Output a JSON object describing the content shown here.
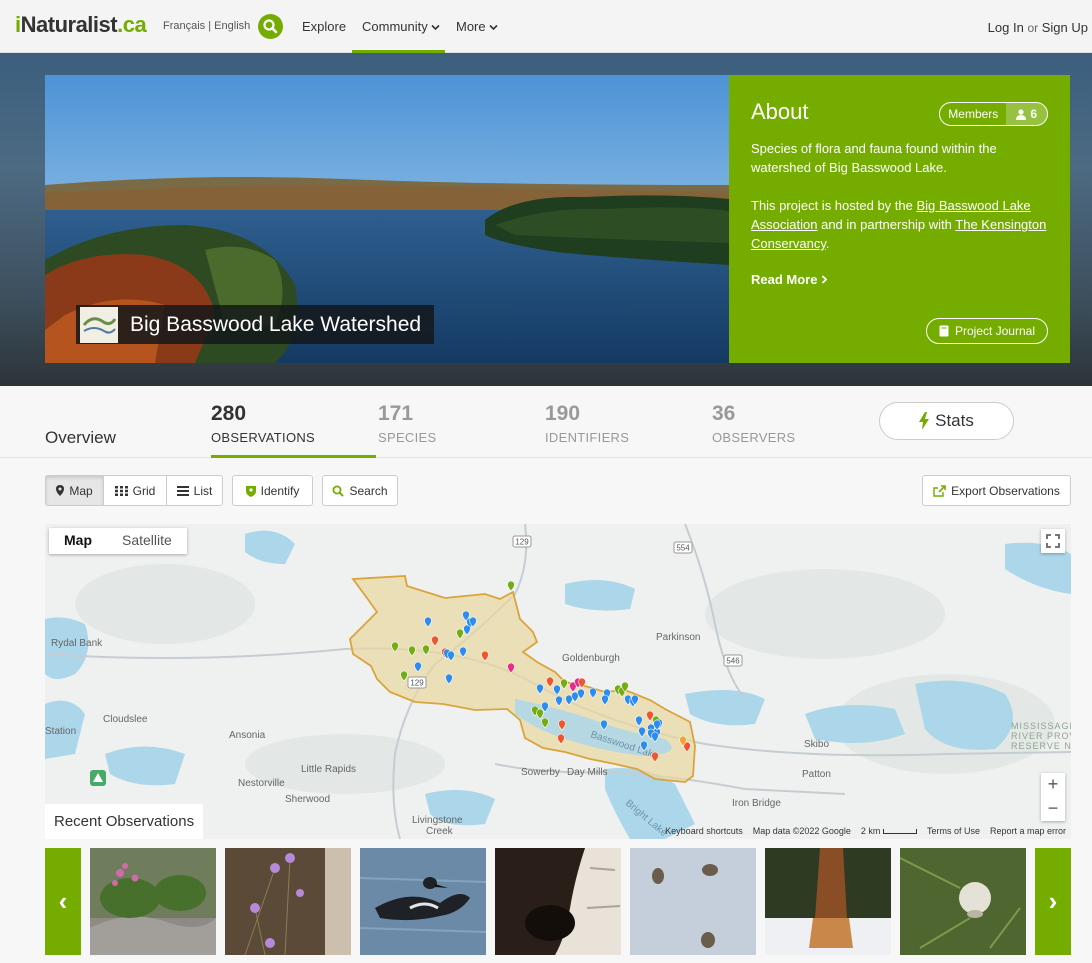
{
  "nav": {
    "logo_i": "i",
    "logo_main": "Naturalist",
    "logo_ca": ".ca",
    "lang_fr": "Français",
    "lang_sep": "|",
    "lang_en": "English",
    "explore": "Explore",
    "community": "Community",
    "more": "More",
    "login": "Log In",
    "or": "or",
    "signup": "Sign Up"
  },
  "project": {
    "title": "Big Basswood Lake Watershed",
    "logo_text": "Big Basswood Lake Association",
    "about_heading": "About",
    "members_label": "Members",
    "members_count": "6",
    "desc": "Species of flora and fauna found within the watershed of Big Basswood Lake.",
    "hosted_prefix": "This project is hosted by the ",
    "host_link": "Big Basswood Lake Association",
    "partner_mid": " and in partnership with ",
    "partner_link": "The Kensington Conservancy",
    "partner_end": ".",
    "read_more": "Read More",
    "journal": "Project Journal"
  },
  "stats": {
    "overview": "Overview",
    "observations_n": "280",
    "observations_l": "OBSERVATIONS",
    "species_n": "171",
    "species_l": "SPECIES",
    "identifiers_n": "190",
    "identifiers_l": "IDENTIFIERS",
    "observers_n": "36",
    "observers_l": "OBSERVERS",
    "stats_btn": "Stats"
  },
  "toolbar": {
    "map": "Map",
    "grid": "Grid",
    "list": "List",
    "identify": "Identify",
    "search": "Search",
    "export": "Export Observations"
  },
  "map": {
    "tab_map": "Map",
    "tab_satellite": "Satellite",
    "labels": {
      "rydal_bank": "Rydal Bank",
      "station": "Station",
      "cloudslee": "Cloudslee",
      "ansonia": "Ansonia",
      "nestorville": "Nestorville",
      "little_rapids": "Little Rapids",
      "sherwood": "Sherwood",
      "livingstone": "Livingstone",
      "creek": "Creek",
      "sowerby": "Sowerby",
      "day_mills": "Day Mills",
      "goldenburgh": "Goldenburgh",
      "parkinson": "Parkinson",
      "skibo": "Skibo",
      "patton": "Patton",
      "iron_bridge": "Iron Bridge",
      "basswood_lake": "Basswood Lake",
      "bright_lake": "Bright Lake",
      "missis1": "MISSISSAGI",
      "missis2": "RIVER PROVINCIAL",
      "missis3": "RESERVE NO",
      "hwy129a": "129",
      "hwy129b": "129",
      "hwy554": "554",
      "hwy546": "546"
    },
    "zoom_in": "+",
    "zoom_out": "−",
    "attr_keyboard": "Keyboard shortcuts",
    "attr_data": "Map data ©2022 Google",
    "attr_scale": "2 km",
    "attr_terms": "Terms of Use",
    "attr_report": "Report a map error"
  },
  "recent": {
    "label": "Recent Observations",
    "prev": "‹",
    "next": "›"
  },
  "colors": {
    "brand": "#74ac00",
    "pin_blue": "#2d8cf0",
    "pin_green": "#73ac13",
    "pin_red": "#f0552d",
    "pin_pink": "#e72c8a",
    "watershed_fill": "#ead7a0",
    "watershed_stroke": "#d9a43b"
  }
}
